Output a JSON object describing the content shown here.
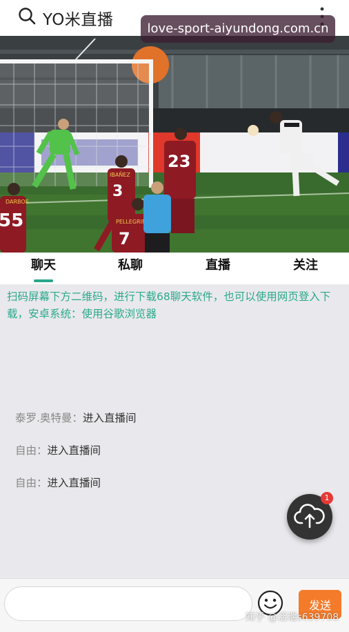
{
  "header": {
    "title": "YO米直播",
    "search_icon": "search-icon",
    "menu_icon": "more-vertical-icon"
  },
  "overlay": {
    "url": "love-sport-aiyundong.com.cn"
  },
  "video": {
    "jersey_numbers": [
      "55",
      "3",
      "23",
      "7"
    ],
    "player_names": [
      "DARBOE",
      "IBAÑEZ",
      "PELLEGRINI"
    ],
    "colors": {
      "roma_kit": "#8e1a23",
      "pitch": "#3a6b2e",
      "keeper_kit": "#52c24a",
      "referee": "#3fa2dc"
    }
  },
  "tabs": [
    {
      "label": "聊天",
      "active": true
    },
    {
      "label": "私聊",
      "active": false
    },
    {
      "label": "直播",
      "active": false
    },
    {
      "label": "关注",
      "active": false
    }
  ],
  "chat": {
    "notice": "扫码屏幕下方二维码，进行下载68聊天软件，也可以使用网页登入下载，安卓系统：使用谷歌浏览器",
    "messages": [
      {
        "user": "泰罗.奥特曼：",
        "text": "进入直播间"
      },
      {
        "user": "自由：",
        "text": "进入直播间"
      },
      {
        "user": "自由：",
        "text": "进入直播间"
      }
    ]
  },
  "fab": {
    "icon": "cloud-upload-icon",
    "badge": "1"
  },
  "composer": {
    "placeholder": "",
    "emoji_icon": "emoji-icon",
    "send_label": "发送"
  },
  "watermark": "知乎 @活瑞s639708",
  "colors": {
    "accent": "#27a68a",
    "send": "#f47b2a",
    "badge": "#e53935",
    "fab": "#333333"
  }
}
